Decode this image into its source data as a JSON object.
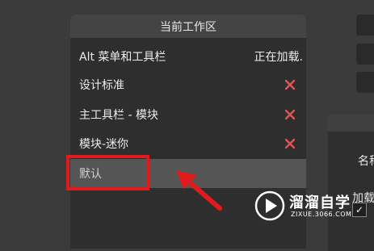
{
  "panel": {
    "title": "当前工作区",
    "items": [
      {
        "label": "Alt 菜单和工具栏",
        "status": "正在加载.",
        "deletable": false
      },
      {
        "label": "设计标准",
        "status": "",
        "deletable": true
      },
      {
        "label": "主工具栏 - 模块",
        "status": "",
        "deletable": true
      },
      {
        "label": "模块-迷你",
        "status": "",
        "deletable": true
      },
      {
        "label": "默认",
        "status": "",
        "deletable": false,
        "selected": true
      }
    ]
  },
  "right_panel": {
    "label_name": "名称",
    "label_loading": "加载",
    "checkbox_mark": "✓"
  },
  "watermark": {
    "title": "溜溜自学",
    "url": "ZIXUE.3066.COM"
  },
  "colors": {
    "background": "#3b3b3b",
    "panel": "#2e2e2e",
    "panel_header": "#444444",
    "selected_row": "#555555",
    "delete_icon": "#e05555",
    "highlight": "#e11b1b"
  },
  "icons": {
    "delete": "close-x-icon",
    "pointer": "red-arrow-icon",
    "logo": "play-logo-icon"
  }
}
